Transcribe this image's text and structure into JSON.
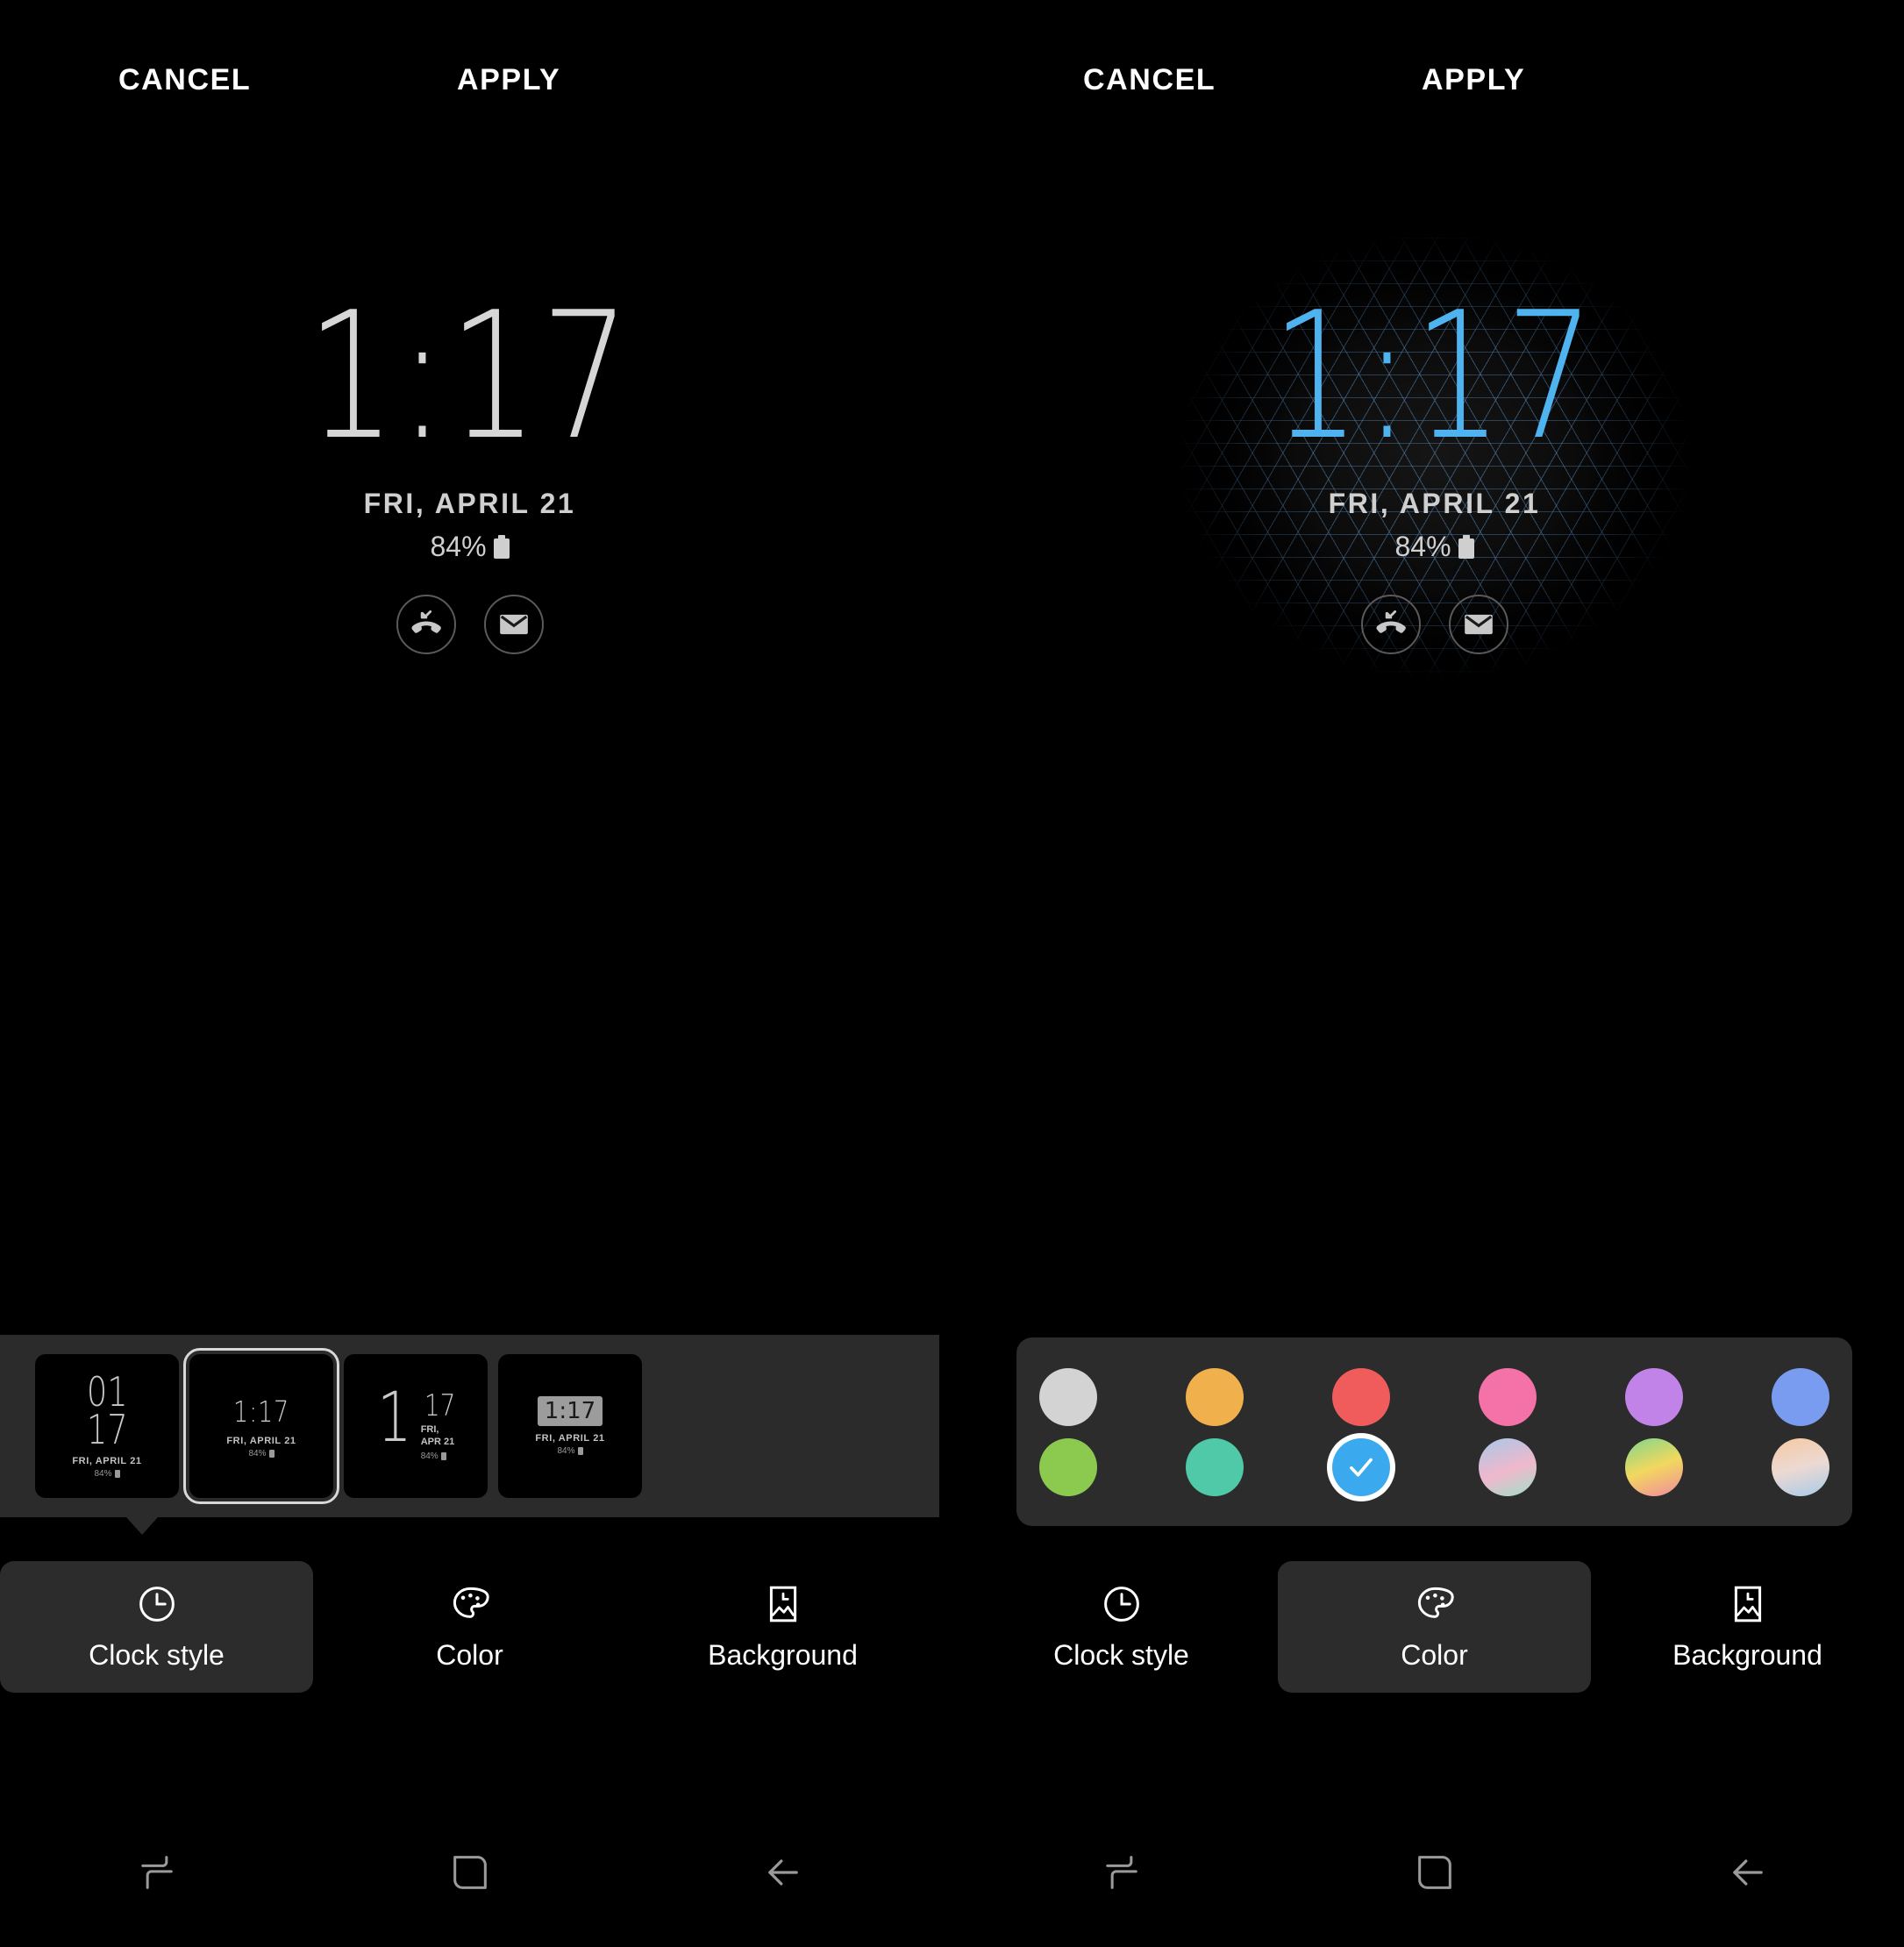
{
  "actions": {
    "cancel": "CANCEL",
    "apply": "APPLY"
  },
  "lockscreen": {
    "time": "1:17",
    "date": "FRI, APRIL 21",
    "battery": "84%",
    "battery_icon": "battery-full-icon",
    "shortcuts": [
      {
        "name": "missed-call-icon",
        "label": "Missed call"
      },
      {
        "name": "email-icon",
        "label": "Email"
      }
    ]
  },
  "left_panel": {
    "clock_color": "#d6d6d6",
    "clock_styles": [
      {
        "id": "style-stacked",
        "time_line1": "01",
        "time_line2": "17",
        "date": "FRI, APRIL 21",
        "battery": "84%",
        "selected": false
      },
      {
        "id": "style-inline",
        "time": "1:17",
        "date": "FRI, APRIL 21",
        "battery": "84%",
        "selected": true
      },
      {
        "id": "style-bigone",
        "time_big": "1",
        "time_small": "17",
        "date_line1": "FRI,",
        "date_line2": "APR 21",
        "battery": "84%",
        "selected": false
      },
      {
        "id": "style-chip",
        "time": "1:17",
        "date": "FRI, APRIL 21",
        "battery": "84%",
        "selected": false
      }
    ]
  },
  "right_panel": {
    "clock_color": "#4fb3f0",
    "background": "triangular-mesh-pattern",
    "colors": [
      {
        "id": "color-white",
        "hex": "#d3d3d3",
        "selected": false
      },
      {
        "id": "color-amber",
        "hex": "#f0b14c",
        "selected": false
      },
      {
        "id": "color-red",
        "hex": "#f05b5b",
        "selected": false
      },
      {
        "id": "color-pink",
        "hex": "#f472a8",
        "selected": false
      },
      {
        "id": "color-purple",
        "hex": "#c183e8",
        "selected": false
      },
      {
        "id": "color-blue",
        "hex": "#7a9cf0",
        "selected": false
      },
      {
        "id": "color-green",
        "hex": "#8cc94f",
        "selected": false
      },
      {
        "id": "color-teal",
        "hex": "#4fc9a8",
        "selected": false
      },
      {
        "id": "color-skyblue",
        "hex": "#3aa9ee",
        "selected": true
      },
      {
        "id": "color-gradient-bluepink",
        "hex": "#9ec2e4",
        "gradient": "linear-gradient(160deg,#a8c8e8 0%,#f0b8cc 55%,#9fe0c8 100%)",
        "selected": false
      },
      {
        "id": "color-gradient-greenpink",
        "hex": "#9fd978",
        "gradient": "linear-gradient(160deg,#7fd68c 0%,#f2d85e 50%,#f08aa0 100%)",
        "selected": false
      },
      {
        "id": "color-gradient-peachblue",
        "hex": "#f0c8a0",
        "gradient": "linear-gradient(165deg,#f4c9a2 0%,#ecd9d2 50%,#a8cbe8 100%)",
        "selected": false
      }
    ]
  },
  "tabs": [
    {
      "id": "tab-clock-style",
      "label": "Clock style",
      "icon": "clock-icon"
    },
    {
      "id": "tab-color",
      "label": "Color",
      "icon": "palette-icon"
    },
    {
      "id": "tab-background",
      "label": "Background",
      "icon": "image-clock-icon"
    }
  ],
  "left_active_tab": "Clock style",
  "right_active_tab": "Color",
  "navbar": [
    {
      "id": "nav-recents",
      "icon": "recents-icon"
    },
    {
      "id": "nav-home",
      "icon": "home-icon"
    },
    {
      "id": "nav-back",
      "icon": "back-arrow-icon"
    }
  ]
}
